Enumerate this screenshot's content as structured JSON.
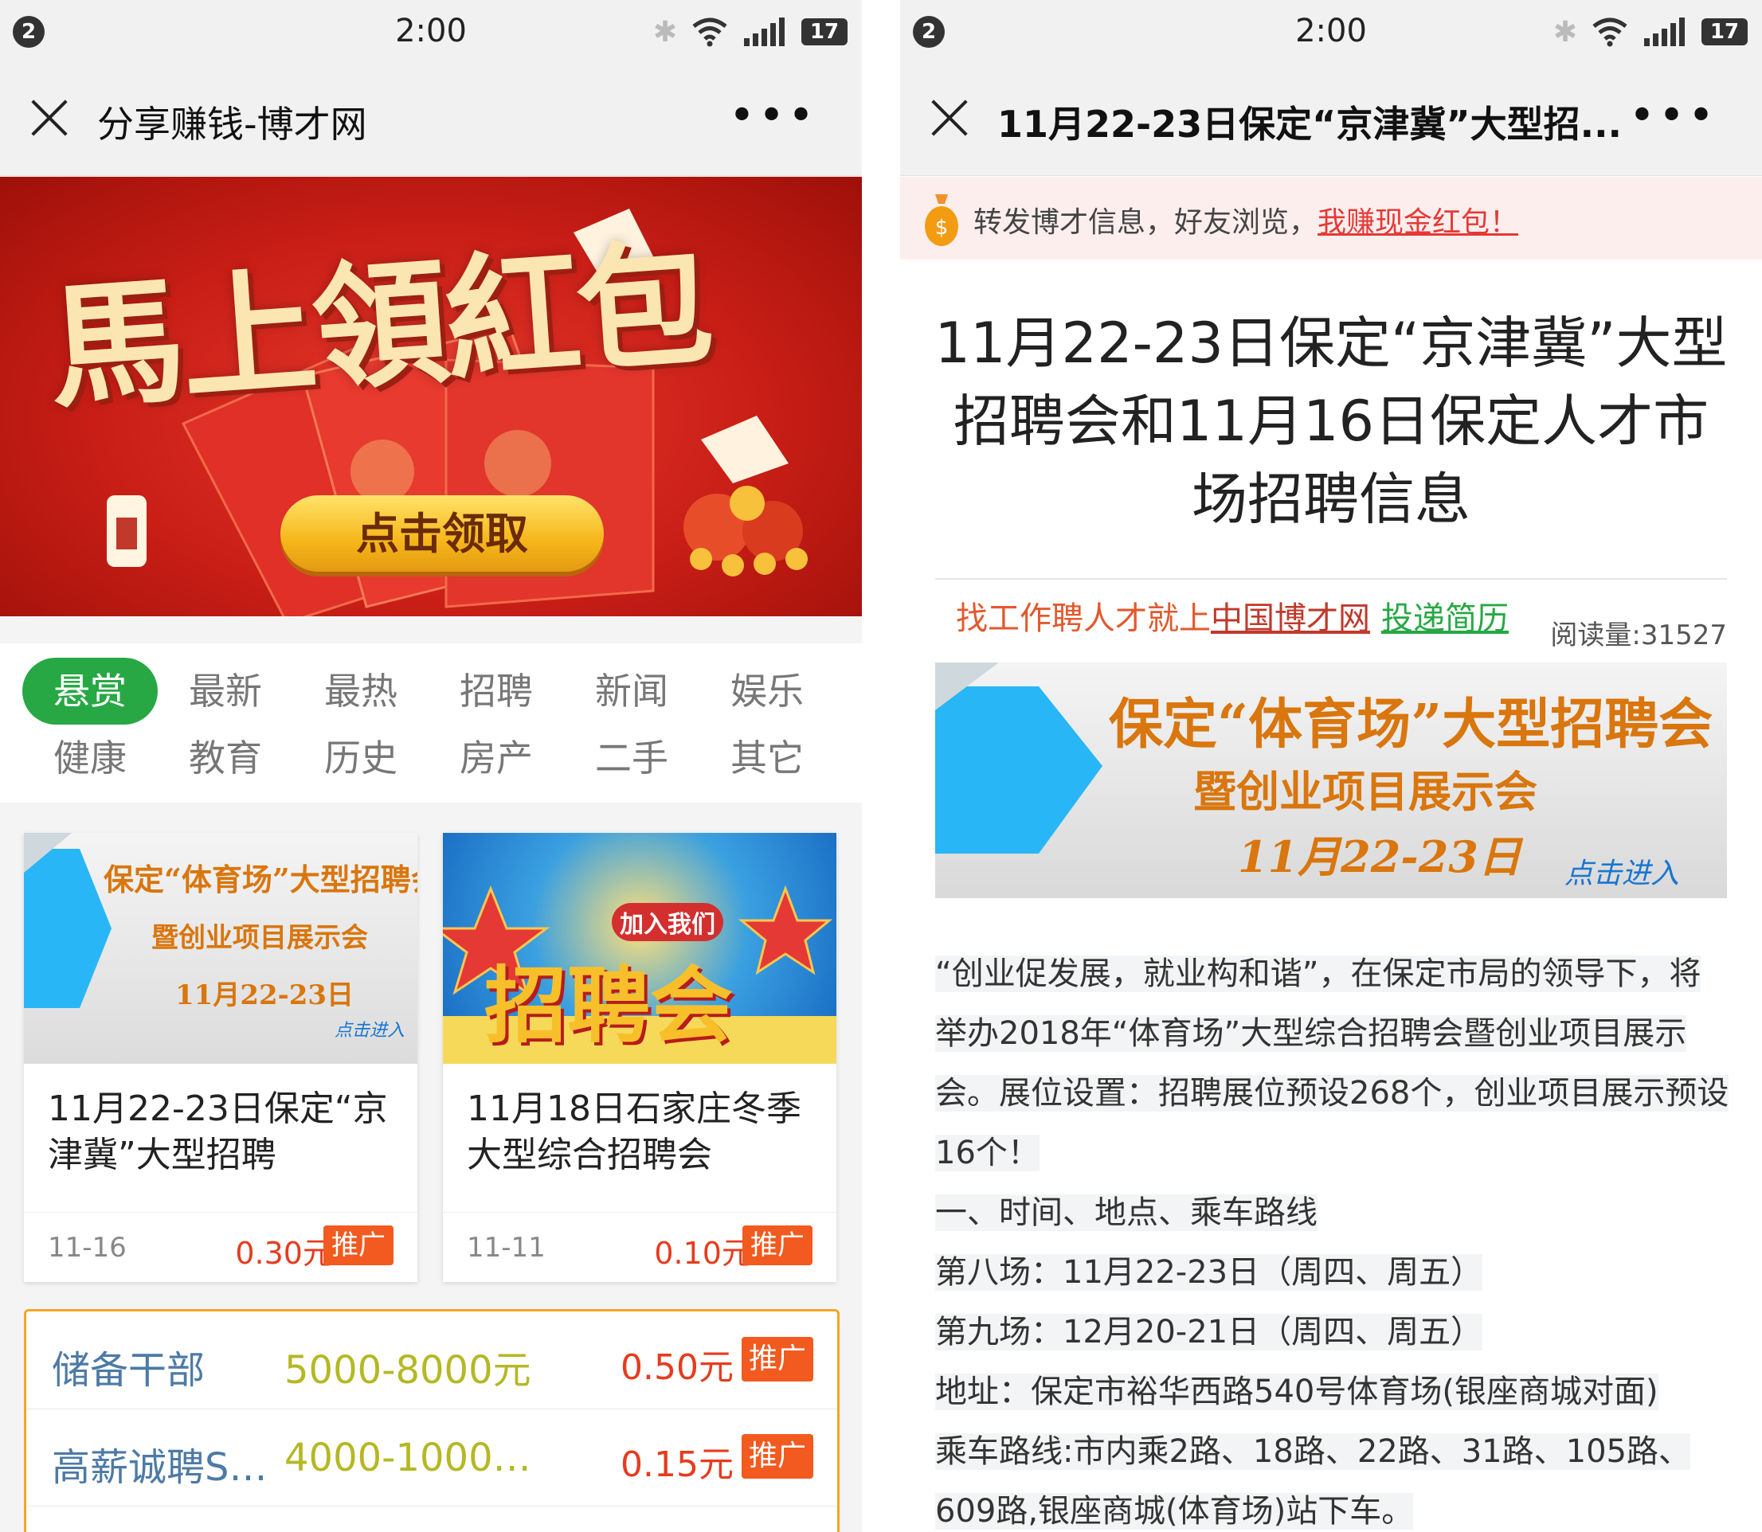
{
  "status": {
    "time": "2:00",
    "notif_count": "2",
    "battery": "17"
  },
  "left": {
    "title": "分享赚钱-博才网",
    "banner": {
      "headline": "馬上領紅包",
      "button": "点击领取"
    },
    "categories": [
      "悬赏",
      "最新",
      "最热",
      "招聘",
      "新闻",
      "娱乐",
      "健康",
      "教育",
      "历史",
      "房产",
      "二手",
      "其它"
    ],
    "cards": [
      {
        "img_lines": [
          "保定“体育场”大型招聘会",
          "暨创业项目展示会",
          "11月22-23日",
          "点击进入"
        ],
        "title": "11月22-23日保定“京津冀”大型招聘",
        "date": "11-16",
        "price": "0.30元",
        "promo": "推广"
      },
      {
        "img_lines": [
          "招聘会",
          "加入我们"
        ],
        "title": "11月18日石家庄冬季大型综合招聘会",
        "date": "11-11",
        "price": "0.10元",
        "promo": "推广"
      }
    ],
    "jobs": [
      {
        "name": "储备干部",
        "salary": "5000-8000元",
        "price": "0.50元",
        "promo": "推广"
      },
      {
        "name": "高薪诚聘SE…",
        "salary": "4000-10000…",
        "price": "0.15元",
        "promo": "推广"
      }
    ]
  },
  "right": {
    "title": "11月22-23日保定“京津冀”大型招...",
    "share_tip": {
      "text": "转发博才信息，好友浏览，",
      "link": "我赚现金红包！"
    },
    "article_title": "11月22-23日保定“京津冀”大型招聘会和11月16日保定人才市场招聘信息",
    "source": {
      "prefix": "找工作聘人才就上",
      "site_link": "中国博才网",
      "resume_link": "投递简历",
      "reads": "阅读量:31527"
    },
    "banner_lines": [
      "保定“体育场”大型招聘会",
      "暨创业项目展示会",
      "11月22-23日",
      "点击进入"
    ],
    "paragraphs": [
      "“创业促发展，就业构和谐”，在保定市局的领导下，将举办2018年“体育场”大型综合招聘会暨创业项目展示会。展位设置：招聘展位预设268个，创业项目展示预设16个！",
      "一、时间、地点、乘车路线",
      "第八场：11月22-23日（周四、周五）",
      "第九场：12月20-21日（周四、周五）",
      "地址：保定市裕华西路540号体育场(银座商城对面)",
      "乘车路线:市内乘2路、18路、22路、31路、105路、609路,银座商城(体育场)站下车。"
    ]
  }
}
